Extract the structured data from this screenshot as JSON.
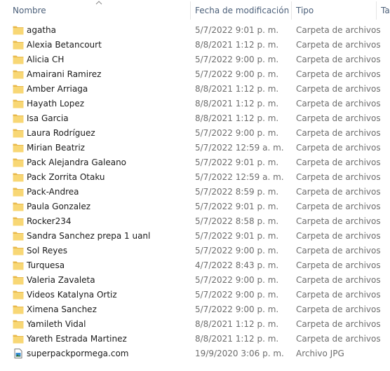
{
  "columns": {
    "name": "Nombre",
    "date": "Fecha de modificación",
    "type": "Tipo",
    "size": "Ta"
  },
  "rows": [
    {
      "name": "agatha",
      "date": "5/7/2022 9:01 p. m.",
      "type": "Carpeta de archivos",
      "icon": "folder-icon"
    },
    {
      "name": "Alexia Betancourt",
      "date": "8/8/2021 1:12 p. m.",
      "type": "Carpeta de archivos",
      "icon": "folder-icon"
    },
    {
      "name": "Alicia CH",
      "date": "5/7/2022 9:00 p. m.",
      "type": "Carpeta de archivos",
      "icon": "folder-icon"
    },
    {
      "name": "Amairani Ramirez",
      "date": "5/7/2022 9:00 p. m.",
      "type": "Carpeta de archivos",
      "icon": "folder-icon"
    },
    {
      "name": "Amber Arriaga",
      "date": "8/8/2021 1:12 p. m.",
      "type": "Carpeta de archivos",
      "icon": "folder-icon"
    },
    {
      "name": "Hayath Lopez",
      "date": "8/8/2021 1:12 p. m.",
      "type": "Carpeta de archivos",
      "icon": "folder-icon"
    },
    {
      "name": "Isa Garcia",
      "date": "8/8/2021 1:12 p. m.",
      "type": "Carpeta de archivos",
      "icon": "folder-icon"
    },
    {
      "name": "Laura Rodríguez",
      "date": "5/7/2022 9:00 p. m.",
      "type": "Carpeta de archivos",
      "icon": "folder-icon"
    },
    {
      "name": "Mirian Beatriz",
      "date": "5/7/2022 12:59 a. m.",
      "type": "Carpeta de archivos",
      "icon": "folder-icon"
    },
    {
      "name": "Pack Alejandra Galeano",
      "date": "5/7/2022 9:01 p. m.",
      "type": "Carpeta de archivos",
      "icon": "folder-icon"
    },
    {
      "name": "Pack Zorrita Otaku",
      "date": "5/7/2022 12:59 a. m.",
      "type": "Carpeta de archivos",
      "icon": "folder-icon"
    },
    {
      "name": "Pack-Andrea",
      "date": "5/7/2022 8:59 p. m.",
      "type": "Carpeta de archivos",
      "icon": "folder-icon"
    },
    {
      "name": "Paula Gonzalez",
      "date": "5/7/2022 9:01 p. m.",
      "type": "Carpeta de archivos",
      "icon": "folder-icon"
    },
    {
      "name": "Rocker234",
      "date": "5/7/2022 8:58 p. m.",
      "type": "Carpeta de archivos",
      "icon": "folder-icon"
    },
    {
      "name": "Sandra Sanchez prepa 1 uanl",
      "date": "5/7/2022 9:01 p. m.",
      "type": "Carpeta de archivos",
      "icon": "folder-icon"
    },
    {
      "name": "Sol Reyes",
      "date": "5/7/2022 9:00 p. m.",
      "type": "Carpeta de archivos",
      "icon": "folder-icon"
    },
    {
      "name": "Turquesa",
      "date": "4/7/2022 8:43 p. m.",
      "type": "Carpeta de archivos",
      "icon": "folder-icon"
    },
    {
      "name": "Valeria Zavaleta",
      "date": "5/7/2022 9:00 p. m.",
      "type": "Carpeta de archivos",
      "icon": "folder-icon"
    },
    {
      "name": "Videos Katalyna Ortiz",
      "date": "5/7/2022 9:00 p. m.",
      "type": "Carpeta de archivos",
      "icon": "folder-icon"
    },
    {
      "name": "Ximena Sanchez",
      "date": "5/7/2022 9:00 p. m.",
      "type": "Carpeta de archivos",
      "icon": "folder-icon"
    },
    {
      "name": "Yamileth Vidal",
      "date": "8/8/2021 1:12 p. m.",
      "type": "Carpeta de archivos",
      "icon": "folder-icon"
    },
    {
      "name": "Yareth Estrada Martinez",
      "date": "8/8/2021 1:12 p. m.",
      "type": "Carpeta de archivos",
      "icon": "folder-icon"
    },
    {
      "name": "superpackpormega.com",
      "date": "19/9/2020 3:06 p. m.",
      "type": "Archivo JPG",
      "icon": "image-file-icon"
    }
  ],
  "colors": {
    "folder_body": "#f8d775",
    "folder_tab": "#e8b84a",
    "header_text": "#4c607a"
  }
}
